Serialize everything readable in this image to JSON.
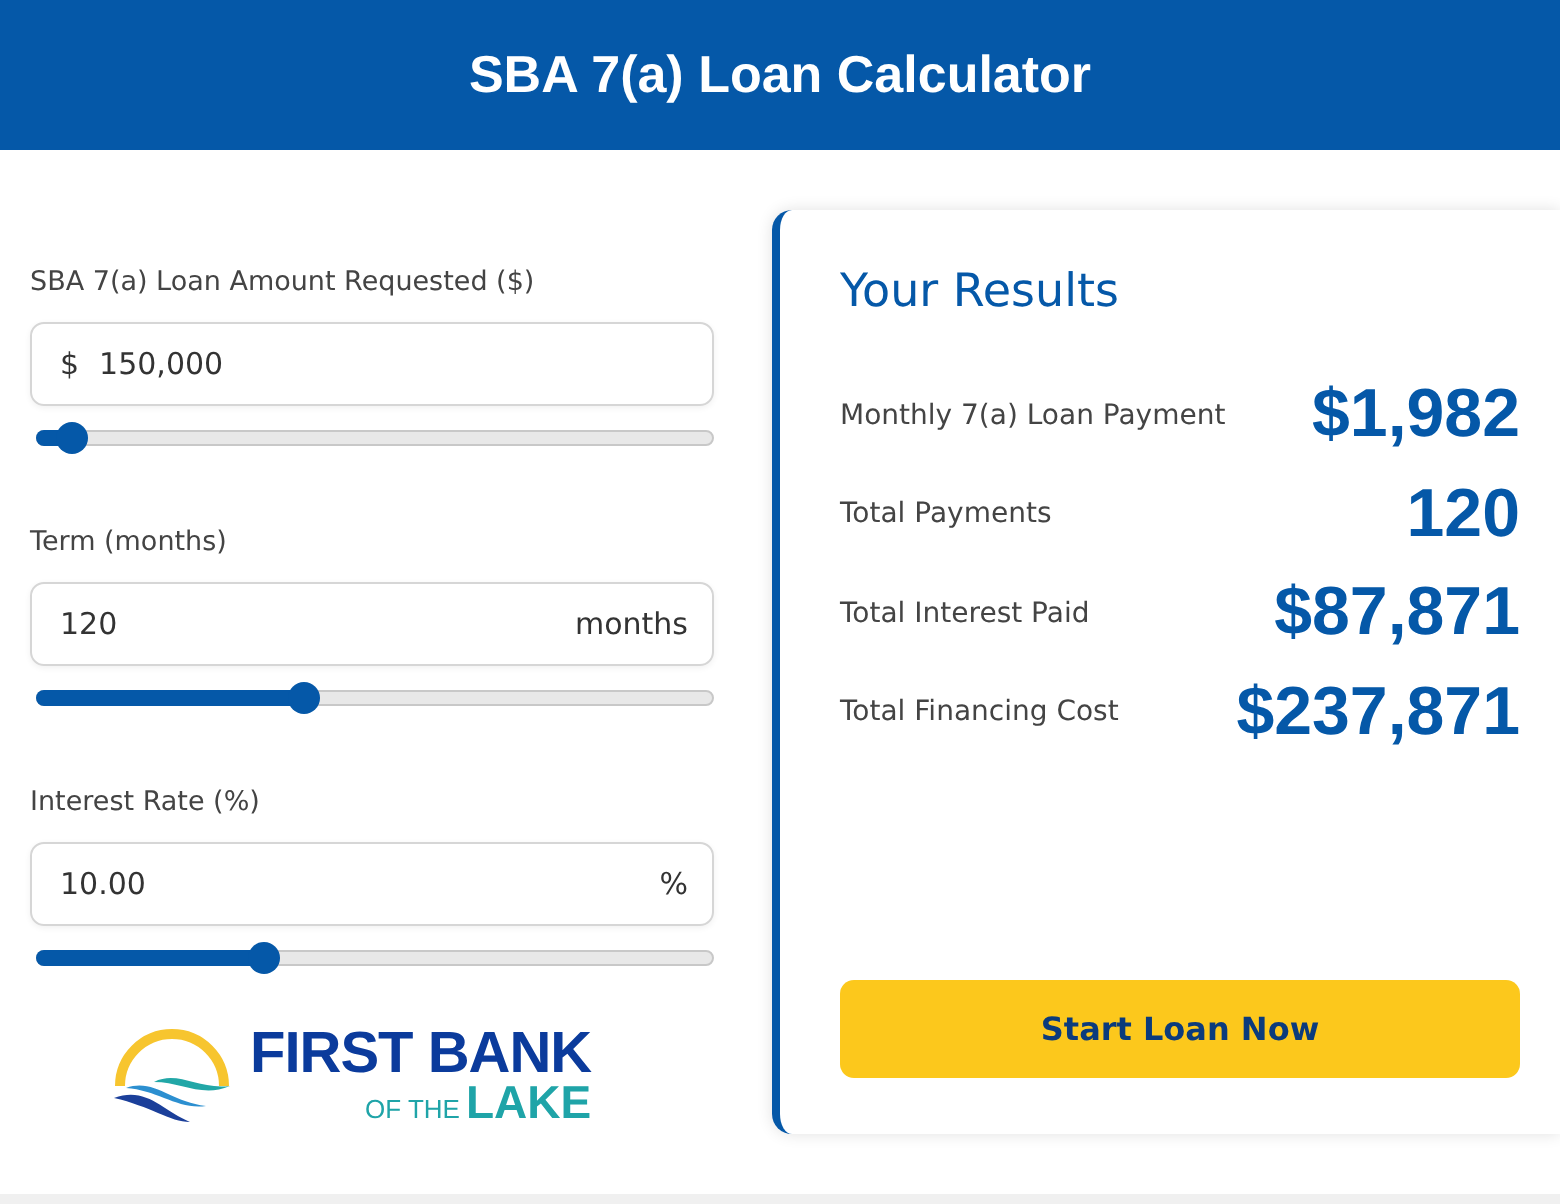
{
  "header": {
    "title": "SBA 7(a) Loan Calculator"
  },
  "inputs": [
    {
      "label": "SBA 7(a) Loan Amount Requested ($)",
      "prefix": "$",
      "value": "150,000",
      "level": 0.05
    },
    {
      "label": "Term (months)",
      "value": "120",
      "suffix": "months",
      "level": 0.395
    },
    {
      "label": "Interest Rate (%)",
      "value": "10.00",
      "suffix": "%",
      "level": 0.336
    }
  ],
  "logo": {
    "line1": "FIRST BANK",
    "line2a": "OF THE",
    "line2b": "LAKE"
  },
  "results": {
    "title": "Your Results",
    "rows": [
      {
        "label": "Monthly 7(a) Loan Payment",
        "value": "$1,982"
      },
      {
        "label": "Total Payments",
        "value": "120"
      },
      {
        "label": "Total Interest Paid",
        "value": "$87,871"
      },
      {
        "label": "Total Financing Cost",
        "value": "$237,871"
      }
    ],
    "button": "Start Loan Now"
  }
}
